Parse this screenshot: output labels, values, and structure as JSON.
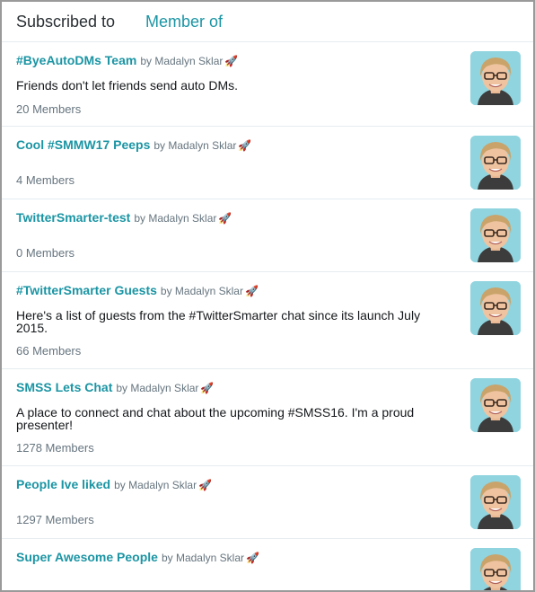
{
  "tabs": {
    "subscribed": "Subscribed to",
    "member": "Member of"
  },
  "lists": [
    {
      "name": "#ByeAutoDMs Team",
      "by": "by Madalyn Sklar",
      "rocket": "🚀",
      "description": "Friends don't let friends send auto DMs.",
      "members": "20 Members"
    },
    {
      "name": "Cool #SMMW17 Peeps",
      "by": "by Madalyn Sklar",
      "rocket": "🚀",
      "description": "",
      "members": "4 Members"
    },
    {
      "name": "TwitterSmarter-test",
      "by": "by Madalyn Sklar",
      "rocket": "🚀",
      "description": "",
      "members": "0 Members"
    },
    {
      "name": "#TwitterSmarter Guests",
      "by": "by Madalyn Sklar",
      "rocket": "🚀",
      "description": "Here's a list of guests from the #TwitterSmarter chat since its launch July 2015.",
      "members": "66 Members"
    },
    {
      "name": "SMSS Lets Chat",
      "by": "by Madalyn Sklar",
      "rocket": "🚀",
      "description": "A place to connect and chat about the upcoming #SMSS16. I'm a proud presenter!",
      "members": "1278 Members"
    },
    {
      "name": "People Ive liked",
      "by": "by Madalyn Sklar",
      "rocket": "🚀",
      "description": "",
      "members": "1297 Members"
    },
    {
      "name": "Super Awesome People",
      "by": "by Madalyn Sklar",
      "rocket": "🚀",
      "description": "",
      "members": ""
    }
  ]
}
